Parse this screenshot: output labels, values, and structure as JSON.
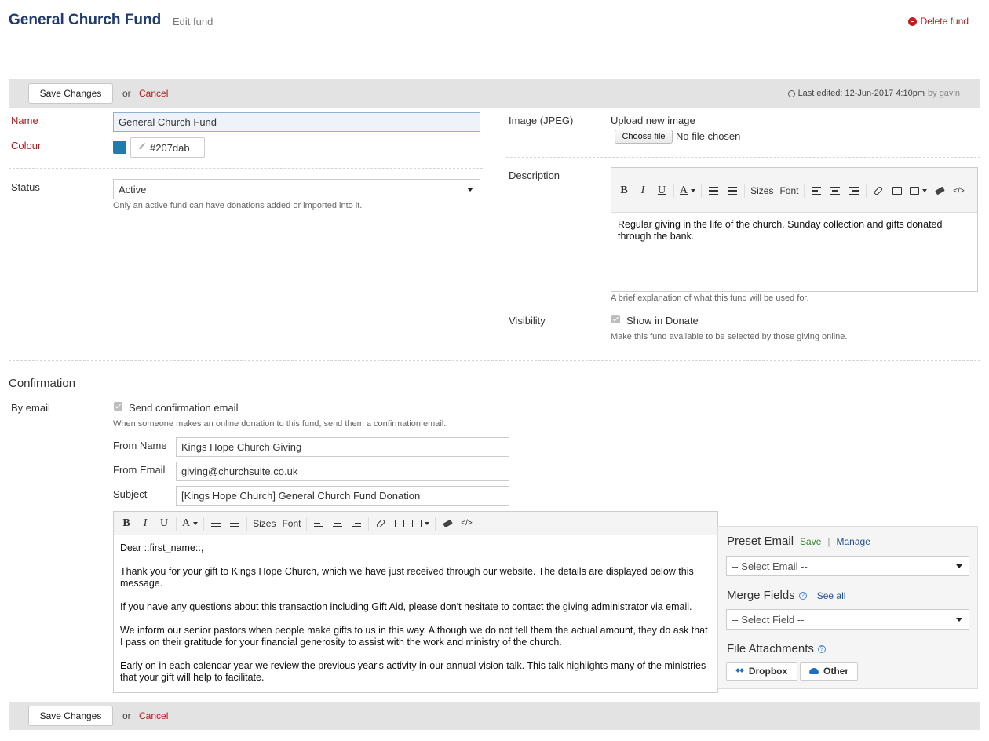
{
  "header": {
    "title": "General Church Fund",
    "subtitle": "Edit fund",
    "delete_label": "Delete fund"
  },
  "actions": {
    "save_label": "Save Changes",
    "or": "or",
    "cancel_label": "Cancel"
  },
  "last_edited": {
    "text": "Last edited: 12-Jun-2017 4:10pm",
    "by": "by gavin"
  },
  "fields": {
    "name_label": "Name",
    "name_value": "General Church Fund",
    "colour_label": "Colour",
    "colour_value": "#207dab",
    "colour_hex": "#207dab",
    "status_label": "Status",
    "status_value": "Active",
    "status_help": "Only an active fund can have donations added or imported into it."
  },
  "image": {
    "label": "Image (JPEG)",
    "upload_label": "Upload new image",
    "choose_file": "Choose file",
    "no_file": "No file chosen"
  },
  "description": {
    "label": "Description",
    "content": "Regular giving in the life of the church. Sunday collection and gifts donated through the bank.",
    "help": "A brief explanation of what this fund will be used for."
  },
  "toolbar": {
    "bold": "B",
    "italic": "I",
    "underline": "U",
    "color": "A",
    "sizes": "Sizes",
    "font": "Font",
    "code": "</>"
  },
  "visibility": {
    "label": "Visibility",
    "checkbox_label": "Show in Donate",
    "help": "Make this fund available to be selected by those giving online."
  },
  "confirmation": {
    "heading": "Confirmation",
    "by_email_label": "By email",
    "send_label": "Send confirmation email",
    "send_help": "When someone makes an online donation to this fund, send them a confirmation email.",
    "from_name_label": "From Name",
    "from_name_value": "Kings Hope Church Giving",
    "from_email_label": "From Email",
    "from_email_value": "giving@churchsuite.co.uk",
    "subject_label": "Subject",
    "subject_value": "[Kings Hope Church] General Church Fund Donation",
    "body": [
      "Dear ::first_name::,",
      "Thank you for your gift to Kings Hope Church, which we have just received through our website. The details are displayed below this message.",
      "If you have any questions about this transaction including Gift Aid, please don't hesitate to contact the giving administrator via email.",
      "We inform our senior pastors when people make gifts to us in this way. Although we do not tell them the actual amount, they do ask that I pass on their gratitude for your financial generosity to assist with the work and ministry of the church.",
      "Early on in each calendar year we review the previous year's activity in our annual vision talk. This talk highlights many of the ministries that your gift will help to facilitate."
    ]
  },
  "side": {
    "preset_title": "Preset Email",
    "preset_save": "Save",
    "preset_sep": "|",
    "preset_manage": "Manage",
    "preset_select": "-- Select Email --",
    "merge_title": "Merge Fields",
    "merge_help": "?",
    "merge_see_all": "See all",
    "merge_select": "-- Select Field --",
    "attach_title": "File Attachments",
    "attach_help": "?",
    "dropbox": "Dropbox",
    "other": "Other"
  }
}
